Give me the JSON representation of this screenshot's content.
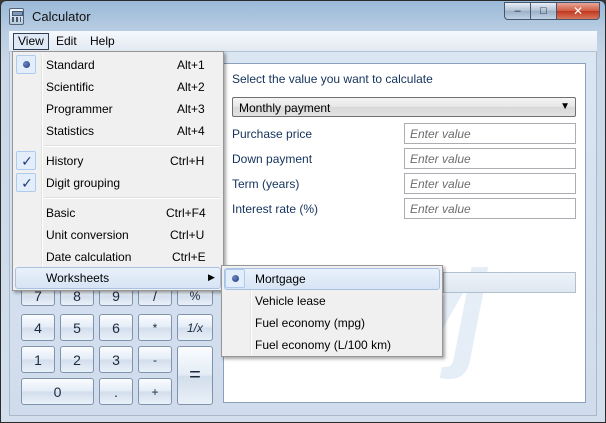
{
  "window": {
    "title": "Calculator",
    "minimize": "–",
    "maximize": "□",
    "close": "✕"
  },
  "menubar": {
    "view": "View",
    "edit": "Edit",
    "help": "Help"
  },
  "view_menu": {
    "standard": {
      "label": "Standard",
      "accel": "Alt+1",
      "selected": true
    },
    "scientific": {
      "label": "Scientific",
      "accel": "Alt+2"
    },
    "programmer": {
      "label": "Programmer",
      "accel": "Alt+3"
    },
    "statistics": {
      "label": "Statistics",
      "accel": "Alt+4"
    },
    "history": {
      "label": "History",
      "accel": "Ctrl+H",
      "checked": true
    },
    "digit_grouping": {
      "label": "Digit grouping",
      "checked": true
    },
    "basic": {
      "label": "Basic",
      "accel": "Ctrl+F4"
    },
    "unit_conversion": {
      "label": "Unit conversion",
      "accel": "Ctrl+U"
    },
    "date_calculation": {
      "label": "Date calculation",
      "accel": "Ctrl+E"
    },
    "worksheets": {
      "label": "Worksheets",
      "arrow": "▶"
    }
  },
  "worksheets_menu": {
    "mortgage": {
      "label": "Mortgage",
      "selected": true
    },
    "vehicle_lease": {
      "label": "Vehicle lease"
    },
    "fuel_mpg": {
      "label": "Fuel economy (mpg)"
    },
    "fuel_l100": {
      "label": "Fuel economy (L/100 km)"
    }
  },
  "keypad": {
    "row_partial": [
      "7",
      "8",
      "9",
      "/",
      "%"
    ],
    "k4": "4",
    "k5": "5",
    "k6": "6",
    "mul": "*",
    "recip": "1/x",
    "k1": "1",
    "k2": "2",
    "k3": "3",
    "minus": "-",
    "k0": "0",
    "dot": ".",
    "plus": "+",
    "equals": "="
  },
  "worksheet": {
    "prompt": "Select the value you want to calculate",
    "selected_value": "Monthly payment",
    "dropdown_arrow": "▼",
    "fields": [
      {
        "label": "Purchase price",
        "placeholder": "Enter value"
      },
      {
        "label": "Down payment",
        "placeholder": "Enter value"
      },
      {
        "label": "Term (years)",
        "placeholder": "Enter value"
      },
      {
        "label": "Interest rate (%)",
        "placeholder": "Enter value"
      }
    ],
    "watermark": "vj"
  },
  "colors": {
    "accent": "#1e3a7a",
    "label_text": "#14335c",
    "highlight": "#d7e4f5"
  }
}
